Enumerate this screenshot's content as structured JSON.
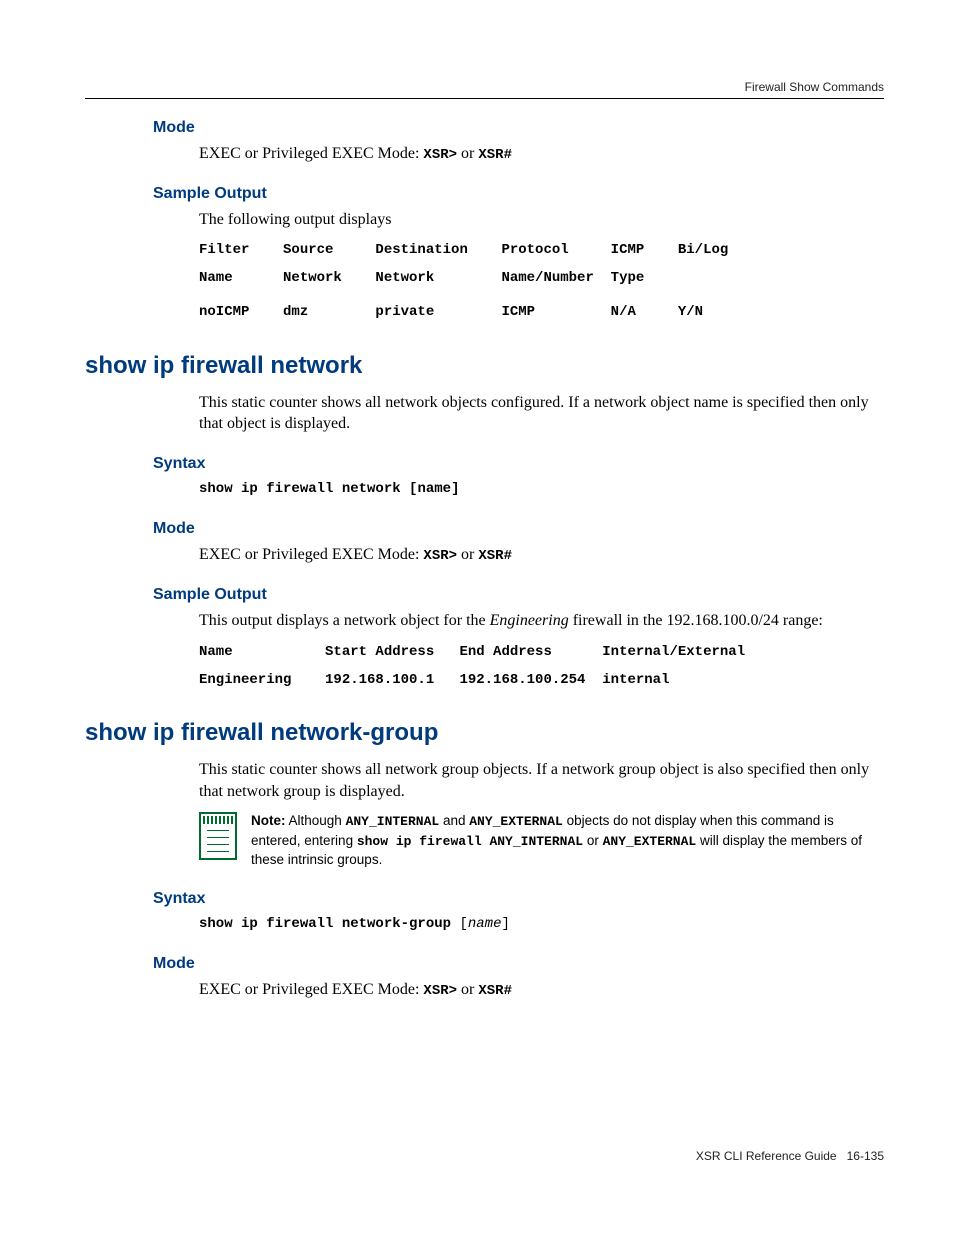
{
  "running_head": "Firewall Show Commands",
  "footer": {
    "guide": "XSR CLI Reference Guide",
    "pageno": "16-135"
  },
  "sec1": {
    "mode_h": "Mode",
    "mode_text_pre": "EXEC or Privileged EXEC Mode: ",
    "mode_code1": "XSR>",
    "mode_or": " or ",
    "mode_code2": "XSR#",
    "sample_h": "Sample Output",
    "sample_intro": "The following output displays",
    "table_header_l1": "Filter    Source     Destination    Protocol     ICMP    Bi/Log",
    "table_header_l2": "Name      Network    Network        Name/Number  Type",
    "table_row": "noICMP    dmz        private        ICMP         N/A     Y/N"
  },
  "sec2": {
    "title": "show ip firewall network",
    "desc": "This static counter shows all network objects configured. If a network object name is specified then only that object is displayed.",
    "syntax_h": "Syntax",
    "syntax_cmd": "show ip firewall network",
    "syntax_open": " [",
    "syntax_arg": "name",
    "syntax_close": "]",
    "mode_h": "Mode",
    "mode_text_pre": "EXEC or Privileged EXEC Mode: ",
    "mode_code1": "XSR>",
    "mode_or": " or ",
    "mode_code2": "XSR#",
    "sample_h": "Sample Output",
    "sample_intro_pre": "This output displays a network object for the ",
    "sample_intro_em": "Engineering",
    "sample_intro_post": " firewall in the 192.168.100.0/24 range:",
    "table_header": "Name           Start Address   End Address      Internal/External",
    "table_row": "Engineering    192.168.100.1   192.168.100.254  internal"
  },
  "sec3": {
    "title": "show ip firewall network-group",
    "desc": "This static counter shows all network group objects. If a network group object is also specified then only that network group is displayed.",
    "note_label": "Note:",
    "note_t1": " Although ",
    "note_c1": "ANY_INTERNAL",
    "note_t2": " and ",
    "note_c2": "ANY_EXTERNAL",
    "note_t3": " objects do not display when this command is entered, entering ",
    "note_c3": "show ip firewall ANY_INTERNAL",
    "note_t4": " or ",
    "note_c4": "ANY_EXTERNAL",
    "note_t5": " will display the members of these intrinsic groups.",
    "syntax_h": "Syntax",
    "syntax_cmd": "show ip firewall network-group",
    "syntax_open": " [",
    "syntax_arg": "name",
    "syntax_close": "]",
    "mode_h": "Mode",
    "mode_text_pre": "EXEC or Privileged EXEC Mode: ",
    "mode_code1": "XSR>",
    "mode_or": " or ",
    "mode_code2": "XSR#"
  }
}
